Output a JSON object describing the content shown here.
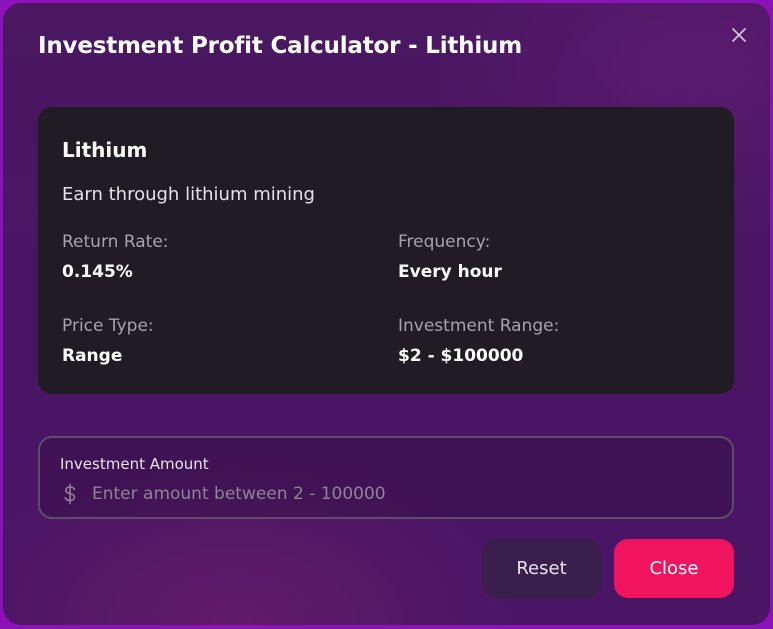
{
  "dialog": {
    "title": "Investment Profit Calculator - Lithium",
    "close_icon": "close-icon"
  },
  "card": {
    "name": "Lithium",
    "description": "Earn through lithium mining",
    "return_rate_label": "Return Rate:",
    "return_rate_value": "0.145%",
    "frequency_label": "Frequency:",
    "frequency_value": "Every hour",
    "price_type_label": "Price Type:",
    "price_type_value": "Range",
    "investment_range_label": "Investment Range:",
    "investment_range_value": "$2 - $100000"
  },
  "amount_field": {
    "label": "Investment Amount",
    "placeholder": "Enter amount between 2 - 100000",
    "value": "",
    "icon": "dollar-icon"
  },
  "actions": {
    "reset_label": "Reset",
    "close_label": "Close"
  },
  "colors": {
    "accent": "#f0145f",
    "background": "#4b1566",
    "card": "#211c23",
    "frame": "#8a12b8"
  }
}
